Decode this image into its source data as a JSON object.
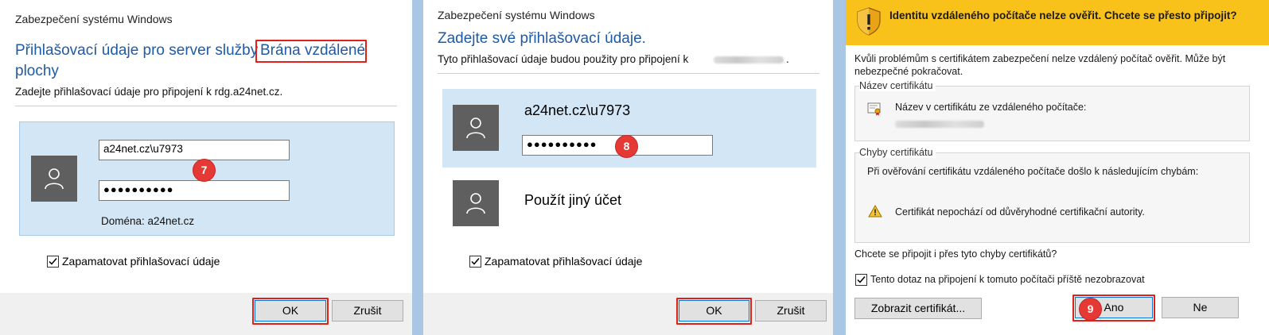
{
  "panel1": {
    "window_title": "Zabezpečení systému Windows",
    "heading_prefix": "Přihlašovací údaje pro server služby",
    "heading_highlight": "Brána vzdálené",
    "heading_line2": "plochy",
    "subtitle": "Zadejte přihlašovací údaje pro připojení k rdg.a24net.cz.",
    "username_value": "a24net.cz\\u7973",
    "password_mask": "●●●●●●●●●●",
    "domain_label": "Doména: a24net.cz",
    "step_badge": "7",
    "remember_label": "Zapamatovat přihlašovací údaje",
    "ok_label": "OK",
    "cancel_label": "Zrušit"
  },
  "panel2": {
    "window_title": "Zabezpečení systému Windows",
    "heading": "Zadejte své přihlašovací údaje.",
    "subtitle": "Tyto přihlašovací údaje budou použity pro připojení k",
    "subtitle_end": ".",
    "account_name": "a24net.cz\\u7973",
    "password_mask": "●●●●●●●●●●",
    "step_badge": "8",
    "other_account_label": "Použít jiný účet",
    "remember_label": "Zapamatovat přihlašovací údaje",
    "ok_label": "OK",
    "cancel_label": "Zrušit"
  },
  "panel3": {
    "warning_title": "Identitu vzdáleného počítače nelze ověřit. Chcete se přesto připojit?",
    "description": "Kvůli problémům s certifikátem zabezpečení nelze vzdálený počítač ověřit. Může být nebezpečné pokračovat.",
    "cert_name_group": "Název certifikátu",
    "cert_name_label": "Název v certifikátu ze vzdáleného počítače:",
    "cert_errors_group": "Chyby certifikátu",
    "cert_errors_intro": "Při ověřování certifikátu vzdáleného počítače došlo k následujícím chybám:",
    "cert_error_item": "Certifikát nepochází od důvěryhodné certifikační autority.",
    "question": "Chcete se připojit i přes tyto chyby certifikátů?",
    "dont_ask_label": "Tento dotaz na připojení k tomuto počítači příště nezobrazovat",
    "view_cert_label": "Zobrazit certifikát...",
    "yes_label": "Ano",
    "no_label": "Ne",
    "step_badge": "9"
  },
  "colors": {
    "accent_blue": "#1f5aa6",
    "tile_blue": "#d3e6f5",
    "highlight_red": "#e0201b",
    "badge_red": "#e53935",
    "warning_yellow": "#f8c21b",
    "desktop_blue": "#a9c7e4"
  },
  "icons": [
    "user-icon",
    "checkmark-icon",
    "shield-warning-icon",
    "certificate-icon",
    "warning-triangle-icon"
  ]
}
